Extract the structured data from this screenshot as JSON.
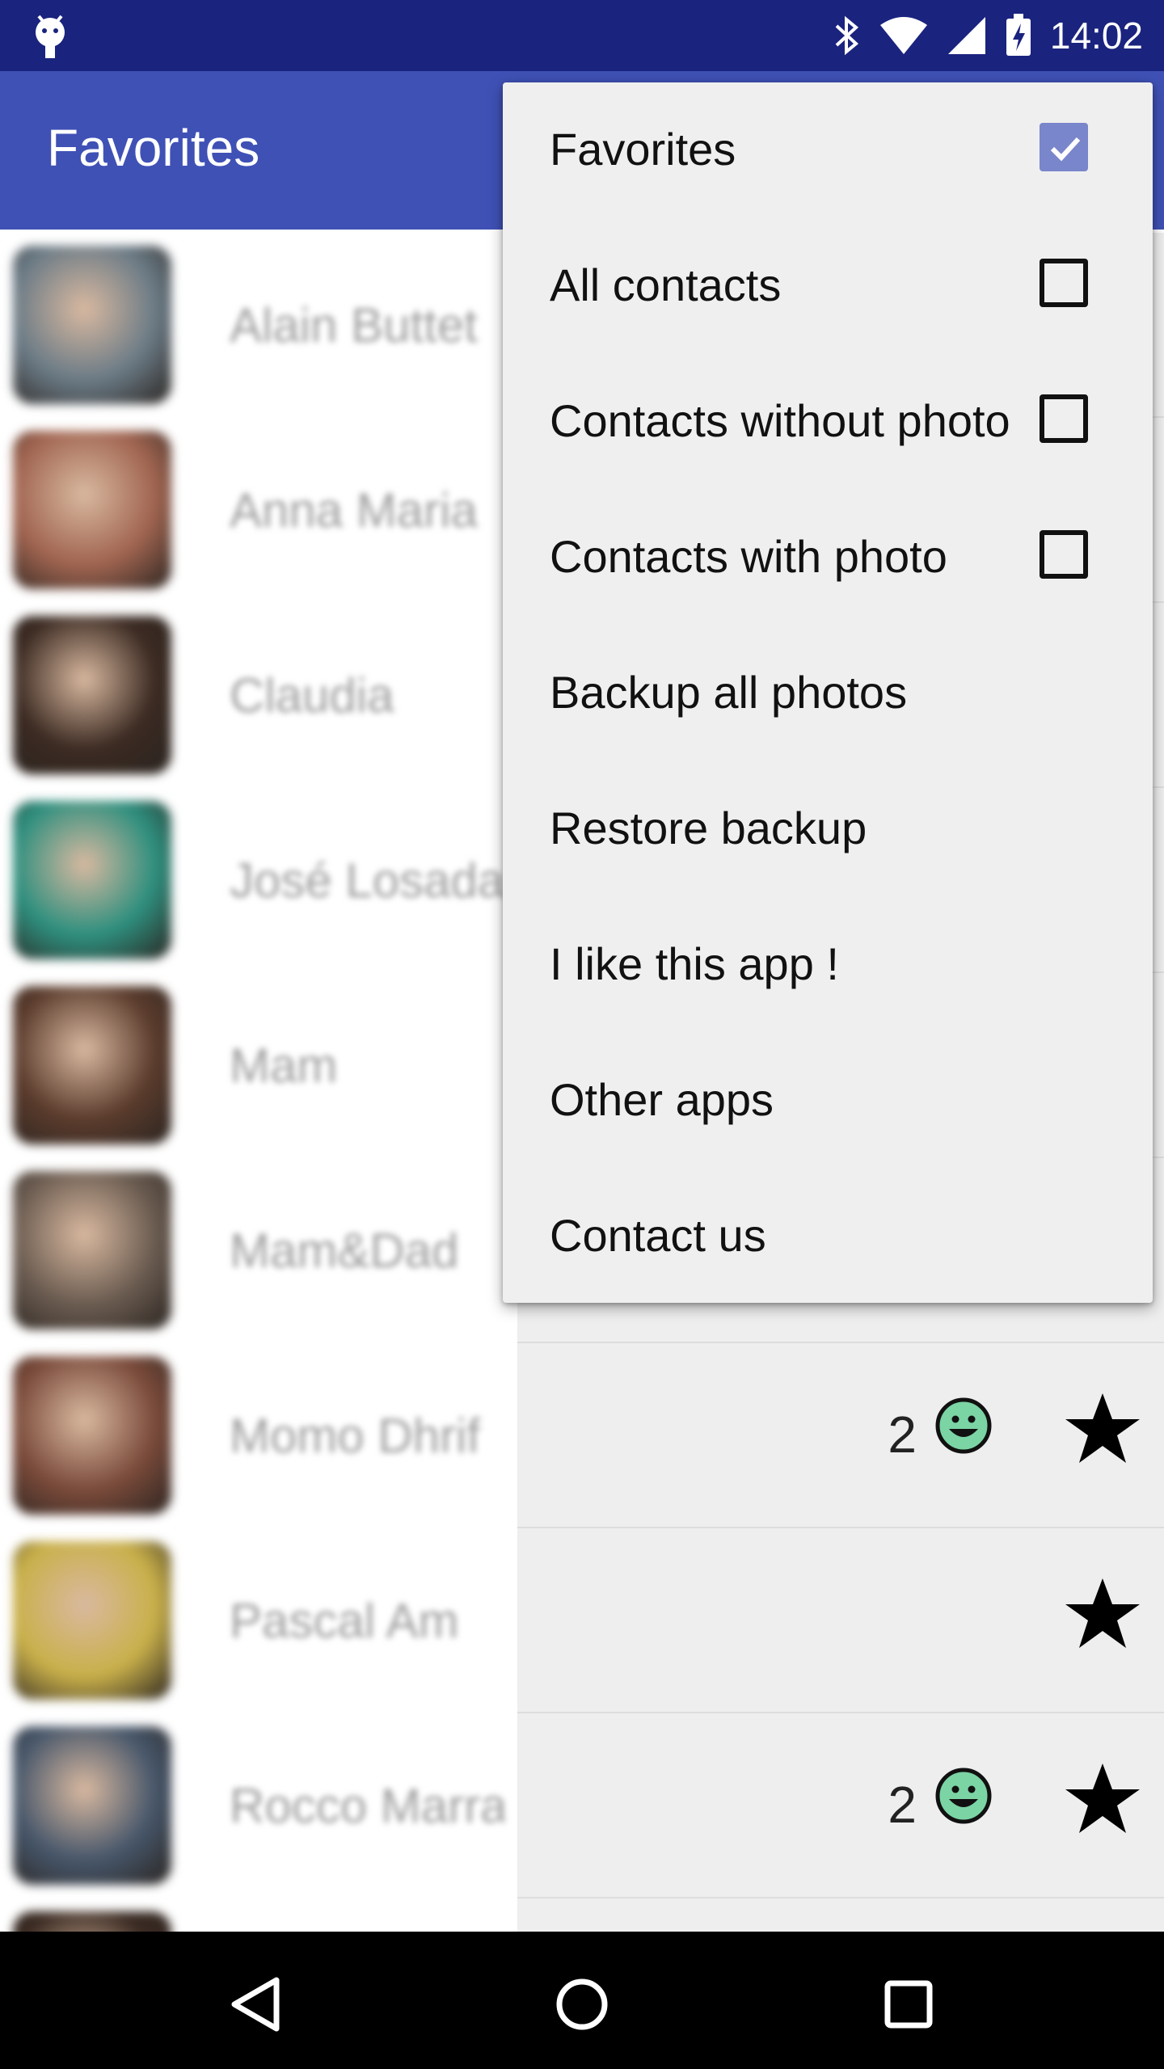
{
  "status_bar": {
    "time": "14:02",
    "icons": [
      "android-icon",
      "bluetooth-icon",
      "wifi-icon",
      "cell-signal-icon",
      "battery-charging-icon"
    ]
  },
  "app_bar": {
    "title": "Favorites"
  },
  "contacts": [
    {
      "name": "Alain Buttet",
      "avatar_color": "#6b7b86",
      "count": "",
      "smiley": false,
      "starred": false
    },
    {
      "name": "Anna Maria",
      "avatar_color": "#a06450",
      "count": "",
      "smiley": false,
      "starred": false
    },
    {
      "name": "Claudia",
      "avatar_color": "#3b2a22",
      "count": "",
      "smiley": false,
      "starred": false
    },
    {
      "name": "José Losada",
      "avatar_color": "#2e8f7e",
      "count": "",
      "smiley": false,
      "starred": false
    },
    {
      "name": "Mam",
      "avatar_color": "#5a3b2c",
      "count": "",
      "smiley": false,
      "starred": false
    },
    {
      "name": "Mam&Dad",
      "avatar_color": "#6a5b50",
      "count": "",
      "smiley": false,
      "starred": false
    },
    {
      "name": "Momo Dhrif",
      "avatar_color": "#7a4a3a",
      "count": "2",
      "smiley": true,
      "starred": true
    },
    {
      "name": "Pascal Am",
      "avatar_color": "#c9b04a",
      "count": "",
      "smiley": false,
      "starred": true
    },
    {
      "name": "Rocco Marra",
      "avatar_color": "#46566a",
      "count": "2",
      "smiley": true,
      "starred": true
    },
    {
      "name": "",
      "avatar_color": "#3a2a22",
      "count": "",
      "smiley": false,
      "starred": false
    }
  ],
  "menu": {
    "items": [
      {
        "label": "Favorites",
        "checkbox": true,
        "checked": true
      },
      {
        "label": "All contacts",
        "checkbox": true,
        "checked": false
      },
      {
        "label": "Contacts without photo",
        "checkbox": true,
        "checked": false
      },
      {
        "label": "Contacts with photo",
        "checkbox": true,
        "checked": false
      },
      {
        "label": "Backup all photos",
        "checkbox": false,
        "checked": false
      },
      {
        "label": "Restore backup",
        "checkbox": false,
        "checked": false
      },
      {
        "label": "I like this app !",
        "checkbox": false,
        "checked": false
      },
      {
        "label": "Other apps",
        "checkbox": false,
        "checked": false
      },
      {
        "label": "Contact us",
        "checkbox": false,
        "checked": false
      }
    ]
  },
  "nav_bar": {
    "buttons": [
      "back-icon",
      "home-icon",
      "recents-icon"
    ]
  },
  "colors": {
    "status_bar": "#1a237e",
    "app_bar": "#3f51b5",
    "accent": "#7986cb",
    "smiley": "#7bd4a4"
  }
}
